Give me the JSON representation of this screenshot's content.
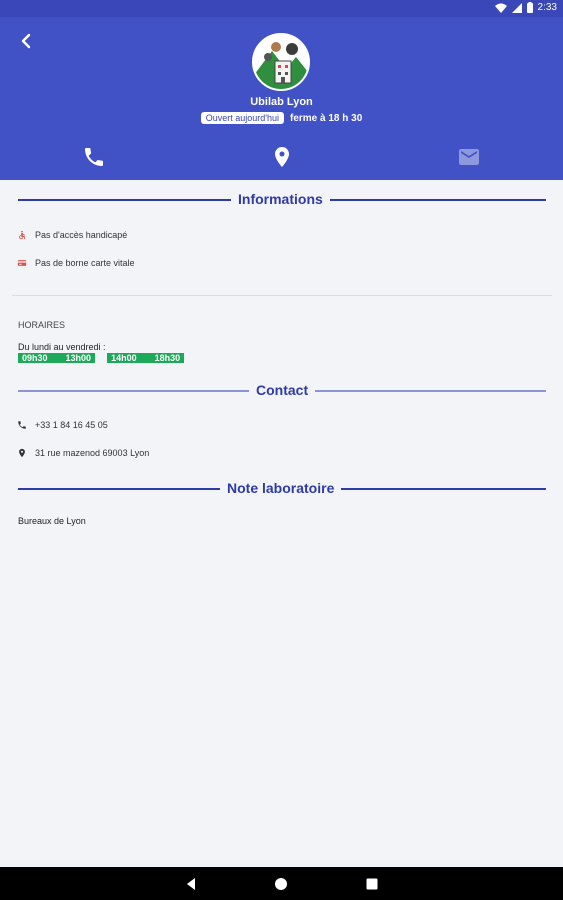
{
  "status_bar": {
    "time": "2:33",
    "icons": [
      "wifi-icon",
      "signal-icon",
      "battery-icon"
    ]
  },
  "header": {
    "lab_name": "Ubilab Lyon",
    "open_badge": "Ouvert aujourd'hui",
    "closing": "ferme à 18 h 30",
    "actions": [
      "phone-icon",
      "location-icon",
      "mail-icon"
    ]
  },
  "informations": {
    "heading": "Informations",
    "items": [
      "Pas d'accès handicapé",
      "Pas de borne carte vitale"
    ]
  },
  "horaires": {
    "label": "HORAIRES",
    "days": "Du lundi au vendredi :",
    "slots": [
      {
        "start": "09h30",
        "end": "13h00"
      },
      {
        "start": "14h00",
        "end": "18h30"
      }
    ]
  },
  "contact": {
    "heading": "Contact",
    "phone": "+33 1 84 16 45 05",
    "address": "31 rue mazenod 69003 Lyon"
  },
  "note": {
    "heading": "Note laboratoire",
    "text": "Bureaux de Lyon"
  },
  "colors": {
    "primary": "#4152c6",
    "status_bar": "#3a47b8",
    "accent_text": "#2e3aa8",
    "hours_green": "#1ea85a",
    "background": "#f3f4f8"
  }
}
